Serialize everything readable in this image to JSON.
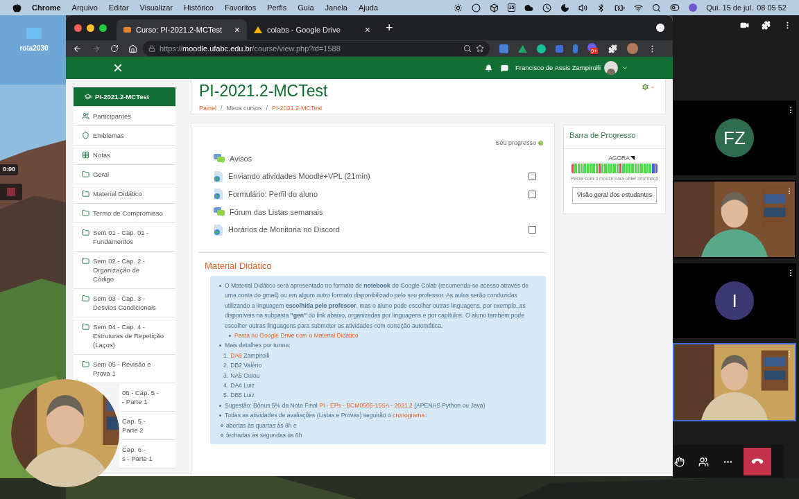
{
  "menu_bar": {
    "app": "Chrome",
    "menus": [
      "Arquivo",
      "Editar",
      "Visualizar",
      "Histórico",
      "Favoritos",
      "Perfis",
      "Guia",
      "Janela",
      "Ajuda"
    ],
    "calendar_day": "15",
    "date": "Qui. 15 de jul.",
    "time": "08 05 52"
  },
  "desktop": {
    "folder": "rota2030",
    "recording_timer": "0:00"
  },
  "browser": {
    "tabs": [
      {
        "title": "Curso: PI-2021.2-MCTest",
        "close": "×",
        "selected": true
      },
      {
        "title": "colabs - Google Drive",
        "close": "×",
        "selected": false
      }
    ],
    "new_tab": "+",
    "url": {
      "scheme": "https://",
      "host": "moodle.ufabc.edu.br",
      "path": "/course/view.php?id=1588"
    },
    "extension_badge": "9+"
  },
  "header": {
    "close": "×",
    "user": "Francisco de Assis Zampirolli"
  },
  "sidebar": [
    {
      "kind": "course",
      "lines": [
        "PI-2021.2-MCTest"
      ],
      "selected": true
    },
    {
      "kind": "people",
      "lines": [
        "Participantes"
      ],
      "selected": false
    },
    {
      "kind": "shield",
      "lines": [
        "Emblemas"
      ],
      "selected": false
    },
    {
      "kind": "grid",
      "lines": [
        "Notas"
      ],
      "selected": false
    },
    {
      "kind": "folder",
      "lines": [
        "Geral"
      ],
      "selected": false
    },
    {
      "kind": "folder",
      "lines": [
        "Material Didático"
      ],
      "selected": false
    },
    {
      "kind": "folder",
      "lines": [
        "Termo de Compromisso"
      ],
      "selected": false
    },
    {
      "kind": "folder",
      "lines": [
        "Sem 01 - Cap. 01 -",
        "Fundamentos"
      ],
      "selected": false
    },
    {
      "kind": "folder",
      "lines": [
        "Sem 02 - Cap. 2 -",
        "Organização de",
        "Código"
      ],
      "selected": false
    },
    {
      "kind": "folder",
      "lines": [
        "Sem 03 - Cap. 3 -",
        "Desvios Condicionais"
      ],
      "selected": false
    },
    {
      "kind": "folder",
      "lines": [
        "Sem 04 - Cap. 4 -",
        "Estruturas de Repetição",
        "(Laços)"
      ],
      "selected": false
    },
    {
      "kind": "folder",
      "lines": [
        "Sem 05 - Revisão e",
        "Prova 1"
      ],
      "selected": false
    },
    {
      "kind": "covered",
      "lines": [
        "06 - Cap. 5 -",
        "- Parte 1"
      ],
      "selected": false
    },
    {
      "kind": "covered",
      "lines": [
        "Cap. 5 -",
        "Parte 2"
      ],
      "selected": false
    },
    {
      "kind": "covered",
      "lines": [
        "Cap. 6 -",
        "s - Parte 1"
      ],
      "selected": false
    }
  ],
  "course": {
    "title": "PI-2021.2-MCTest",
    "breadcrumb": [
      {
        "text": "Painel",
        "link": true
      },
      {
        "text": "Meus cursos",
        "link": false
      },
      {
        "text": "PI-2021.2-MCTest",
        "link": true
      }
    ],
    "breadcrumb_separator": "/"
  },
  "progress_label": "Seu progresso",
  "activities": [
    {
      "name": "Avisos",
      "kind": "forum"
    },
    {
      "name": "Enviando atividades Moodle+VPL (21min)",
      "kind": "url",
      "checkbox": {
        "checked": false
      }
    },
    {
      "name": "Formulário: Perfil do aluno",
      "kind": "url",
      "checkbox": {
        "checked": false
      }
    },
    {
      "name": "Fórum das Listas semanais",
      "kind": "forum"
    },
    {
      "name": "Horários de Monitoria no Discord",
      "kind": "url",
      "checkbox": {
        "checked": false
      }
    }
  ],
  "section": {
    "title": "Material Didático",
    "items": [
      {
        "kind": "bullet",
        "parts": [
          {
            "text": "O Material Didático será apresentado no formato de **notebook** do Google Colab (recomenda-se acesso através de uma conta do gmail) ou em algum outro formato disponibilizado pelo seu professor. As aulas serão conduzidas utilizando a linguagem **escolhida pelo professor**, mas o aluno pode escolher outras linguagens, por exemplo, as disponíveis na subpasta **\"gen\"** do link abaixo, organizadas por linguagens e por capítulos. O aluno também pode escolher outras linguagens para submeter as atividades com correção automática.",
            "link": false
          }
        ],
        "children": [
          {
            "kind": "bullet",
            "parts": [
              {
                "text": "Pasta no Google Drive com o Material Didático",
                "link": true
              }
            ]
          }
        ]
      },
      {
        "kind": "bullet",
        "parts": [
          {
            "text": "Mais detalhes por turma:",
            "link": false
          }
        ],
        "children": [
          {
            "kind": "number",
            "number": "1.",
            "parts": [
              {
                "text": "DA6",
                "link": true
              },
              {
                "text": "Zampirolli",
                "link": false
              }
            ]
          },
          {
            "kind": "number",
            "number": "2.",
            "parts": [
              {
                "text": "DB2 Valério",
                "link": false
              }
            ]
          },
          {
            "kind": "number",
            "number": "3.",
            "parts": [
              {
                "text": "NA5 Guiou",
                "link": false
              }
            ]
          },
          {
            "kind": "number",
            "number": "4.",
            "parts": [
              {
                "text": "DA4 Luiz",
                "link": false
              }
            ]
          },
          {
            "kind": "number",
            "number": "5.",
            "parts": [
              {
                "text": "DB5 Luiz",
                "link": false
              }
            ]
          }
        ]
      },
      {
        "kind": "bullet",
        "parts": [
          {
            "text": "Sugestão: Bônus 5% da Nota Final",
            "link": false
          },
          {
            "text": "PI - EPs - BCM0505-15SA - 2021.2",
            "link": true
          },
          {
            "text": "(APENAS Python ou Java)",
            "link": false
          }
        ]
      },
      {
        "kind": "bullet",
        "parts": [
          {
            "text": "Todas as atividades de avaliações (Listas e Provas) seguirão o",
            "link": false
          },
          {
            "text": "cronograma",
            "link": true
          },
          {
            "text": ":",
            "link": false
          }
        ],
        "children": [
          {
            "kind": "circle",
            "parts": [
              {
                "text": "abertas às quartas às 8h e",
                "link": false
              }
            ]
          },
          {
            "kind": "circle",
            "parts": [
              {
                "text": "fechadas às segundas às 6h",
                "link": false
              }
            ]
          }
        ]
      }
    ]
  },
  "block": {
    "title": "Barra de Progresso",
    "now": "AGORA",
    "hint": "Passe com o mouse para obter informaçõ",
    "button": "Visão geral dos estudantes",
    "segments": [
      {
        "color": "#e5404f"
      },
      {
        "color": "#4cdc48"
      },
      {
        "color": "#4cdc48"
      },
      {
        "color": "#4cdc48"
      },
      {
        "color": "#4cdc48"
      },
      {
        "color": "#4cdc48"
      },
      {
        "color": "#4cdc48"
      },
      {
        "color": "#4cdc48"
      },
      {
        "color": "#4cdc48"
      },
      {
        "color": "#e5404f"
      },
      {
        "color": "#4cdc48"
      },
      {
        "color": "#4cdc48"
      },
      {
        "color": "#4cdc48"
      },
      {
        "color": "#4cdc48"
      },
      {
        "color": "#4cdc48"
      },
      {
        "color": "#4cdc48"
      },
      {
        "color": "#e5404f"
      },
      {
        "color": "#4cdc48"
      },
      {
        "color": "#4cdc48"
      },
      {
        "color": "#4cdc48"
      },
      {
        "color": "#4cdc48"
      },
      {
        "color": "#4cdc48"
      },
      {
        "color": "#4cdc48"
      },
      {
        "color": "#4cdc48"
      },
      {
        "color": "#4cdc48"
      },
      {
        "color": "#4cdc48"
      },
      {
        "color": "#4cdc48"
      },
      {
        "color": "#5355e8"
      },
      {
        "color": "#5355e8"
      }
    ]
  },
  "call": {
    "tiles": [
      {
        "kind": "avatar",
        "initials": "FZ",
        "color": "#2e6b4f"
      },
      {
        "kind": "video",
        "selected": false
      },
      {
        "kind": "avatar",
        "initials": "I",
        "color": "#3b3770"
      },
      {
        "kind": "video",
        "selected": true
      }
    ]
  }
}
